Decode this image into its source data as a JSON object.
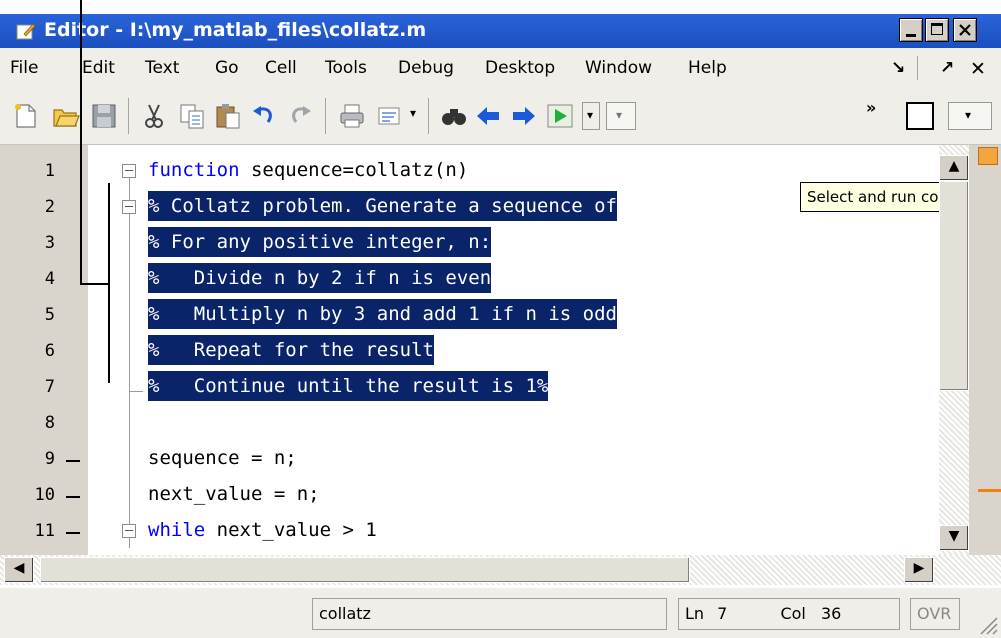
{
  "window": {
    "title": "Editor - I:\\my_matlab_files\\collatz.m",
    "controls": [
      "minimize-icon",
      "maximize-icon",
      "close-icon"
    ]
  },
  "menu": {
    "items": [
      "File",
      "Edit",
      "Text",
      "Go",
      "Cell",
      "Tools",
      "Debug",
      "Desktop",
      "Window",
      "Help"
    ],
    "right_icons": [
      "dock-icon",
      "undock-icon",
      "close-icon"
    ]
  },
  "toolbar": {
    "icons": [
      "new-file-icon",
      "open-file-icon",
      "save-icon",
      "cut-icon",
      "copy-icon",
      "paste-icon",
      "undo-icon",
      "redo-icon",
      "print-icon",
      "comment-icon",
      "find-icon",
      "back-icon",
      "forward-icon",
      "run-icon",
      "run-options-dropdown",
      "layout-dropdown"
    ]
  },
  "editor": {
    "lines": [
      {
        "no": "1",
        "text": "function sequence=collatz(n)",
        "selected": false
      },
      {
        "no": "2",
        "text": "% Collatz problem. Generate a sequence of",
        "selected": true
      },
      {
        "no": "3",
        "text": "% For any positive integer, n:",
        "selected": true
      },
      {
        "no": "4",
        "text": "%   Divide n by 2 if n is even",
        "selected": true
      },
      {
        "no": "5",
        "text": "%   Multiply n by 3 and add 1 if n is odd",
        "selected": true
      },
      {
        "no": "6",
        "text": "%   Repeat for the result",
        "selected": true
      },
      {
        "no": "7",
        "text": "%   Continue until the result is 1%",
        "selected": true
      },
      {
        "no": "8",
        "text": "",
        "selected": false
      },
      {
        "no": "9",
        "text": "sequence = n;",
        "selected": false
      },
      {
        "no": "10",
        "text": "next_value = n;",
        "selected": false
      },
      {
        "no": "11",
        "text": "while next_value > 1",
        "selected": false
      }
    ],
    "keywords": {
      "function": "function",
      "while": "while"
    },
    "rest": {
      "line1": " sequence=collatz(n)",
      "line11": " next_value > 1"
    }
  },
  "tooltip": {
    "text": "Select and run configu"
  },
  "status": {
    "filename": "collatz",
    "ln_label": "Ln",
    "ln_value": "7",
    "col_label": "Col",
    "col_value": "36",
    "mode": "OVR"
  },
  "colors": {
    "selection": "#0a246a",
    "keyword": "#0000ff",
    "titlebar": "#1a4fc0"
  }
}
